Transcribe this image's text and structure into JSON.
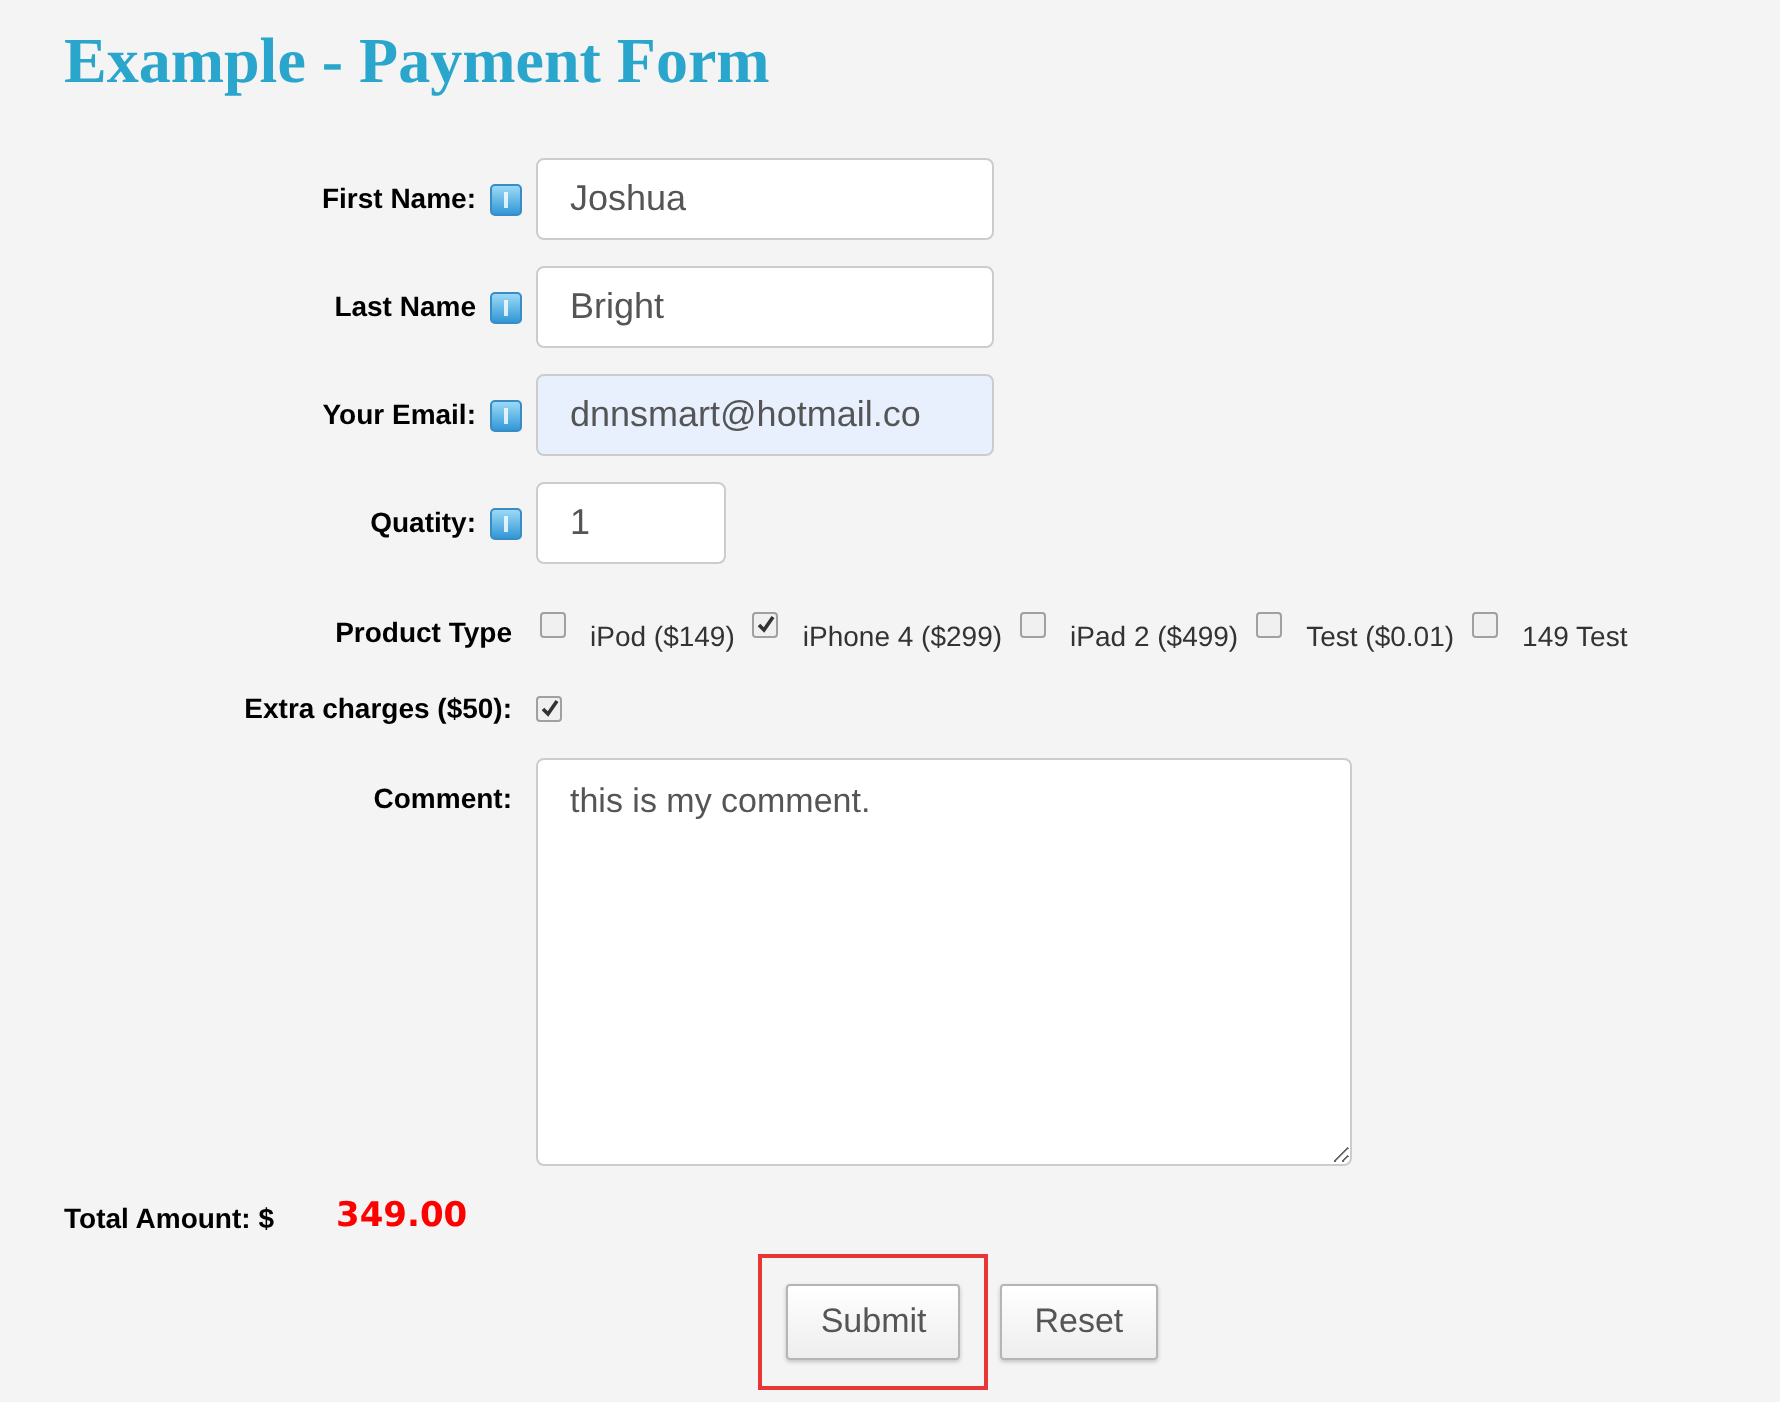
{
  "title": "Example - Payment Form",
  "fields": [
    {
      "kind": "text",
      "label": "First Name:",
      "info": true,
      "value": "Joshua",
      "focused": false
    },
    {
      "kind": "text",
      "label": "Last Name",
      "info": true,
      "value": "Bright",
      "focused": false
    },
    {
      "kind": "text",
      "label": "Your Email:",
      "info": true,
      "value": "dnnsmart@hotmail.co",
      "focused": true
    },
    {
      "kind": "number",
      "label": "Quatity:",
      "info": true,
      "value": "1",
      "focused": false
    },
    {
      "kind": "checkgroup",
      "label": "Product Type",
      "options": [
        {
          "label": "iPod ($149)",
          "checked": false
        },
        {
          "label": "iPhone 4 ($299)",
          "checked": true
        },
        {
          "label": "iPad 2 ($499)",
          "checked": false
        },
        {
          "label": "Test ($0.01)",
          "checked": false
        },
        {
          "label": "149 Test",
          "checked": false
        }
      ]
    },
    {
      "kind": "checkbox",
      "label": "Extra charges ($50):",
      "checked": true
    },
    {
      "kind": "textarea",
      "label": "Comment:",
      "value": "this is my comment."
    }
  ],
  "total": {
    "label": "Total Amount: $",
    "amount": "349.00"
  },
  "buttons": [
    {
      "label": "Submit",
      "highlighted": true
    },
    {
      "label": "Reset",
      "highlighted": false
    }
  ]
}
